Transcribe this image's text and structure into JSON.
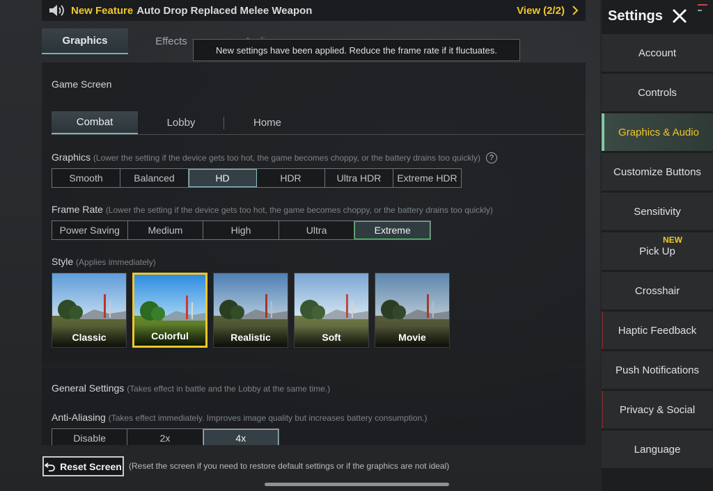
{
  "banner": {
    "new_feature": "New Feature",
    "text": "Auto Drop Replaced Melee Weapon",
    "view": "View (2/2)"
  },
  "main_tabs": [
    {
      "label": "Graphics",
      "active": true
    },
    {
      "label": "Effects"
    },
    {
      "label": "Audio"
    }
  ],
  "toast": "New settings have been applied. Reduce the frame rate if it fluctuates.",
  "game_screen": {
    "title": "Game Screen",
    "tabs": [
      {
        "label": "Combat",
        "active": true
      },
      {
        "label": "Lobby"
      },
      {
        "label": "Home"
      }
    ]
  },
  "graphics": {
    "label": "Graphics",
    "hint": "(Lower the setting if the device gets too hot, the game becomes choppy, or the battery drains too quickly)",
    "help": "?",
    "options": [
      "Smooth",
      "Balanced",
      "HD",
      "HDR",
      "Ultra HDR",
      "Extreme HDR"
    ],
    "selected": "HD"
  },
  "frame_rate": {
    "label": "Frame Rate",
    "hint": "(Lower the setting if the device gets too hot, the game becomes choppy, or the battery drains too quickly)",
    "options": [
      "Power Saving",
      "Medium",
      "High",
      "Ultra",
      "Extreme"
    ],
    "selected": "Extreme"
  },
  "style": {
    "label": "Style",
    "hint": "(Applies immediately)",
    "options": [
      "Classic",
      "Colorful",
      "Realistic",
      "Soft",
      "Movie"
    ],
    "selected": "Colorful"
  },
  "general": {
    "title": "General Settings",
    "hint": "(Takes effect in battle and the Lobby at the same time.)"
  },
  "anti_aliasing": {
    "label": "Anti-Aliasing",
    "hint": "(Takes effect immediately. Improves image quality but increases battery consumption.)",
    "options": [
      "Disable",
      "2x",
      "4x"
    ],
    "selected": "4x"
  },
  "reset": {
    "label": "Reset Screen",
    "note": "(Reset the screen if you need to restore default settings or if the graphics are not ideal)"
  },
  "sidebar": {
    "title": "Settings",
    "items": [
      {
        "label": "Account"
      },
      {
        "label": "Controls"
      },
      {
        "label": "Graphics & Audio",
        "active": true
      },
      {
        "label": "Customize Buttons"
      },
      {
        "label": "Sensitivity"
      },
      {
        "label": "Pick Up",
        "badge": "NEW"
      },
      {
        "label": "Crosshair"
      },
      {
        "label": "Haptic Feedback"
      },
      {
        "label": "Push Notifications"
      },
      {
        "label": "Privacy & Social"
      },
      {
        "label": "Language"
      }
    ]
  },
  "colors": {
    "accent_yellow": "#f0c72a",
    "accent_teal": "#7ab1b6",
    "accent_green": "#57c46a"
  }
}
